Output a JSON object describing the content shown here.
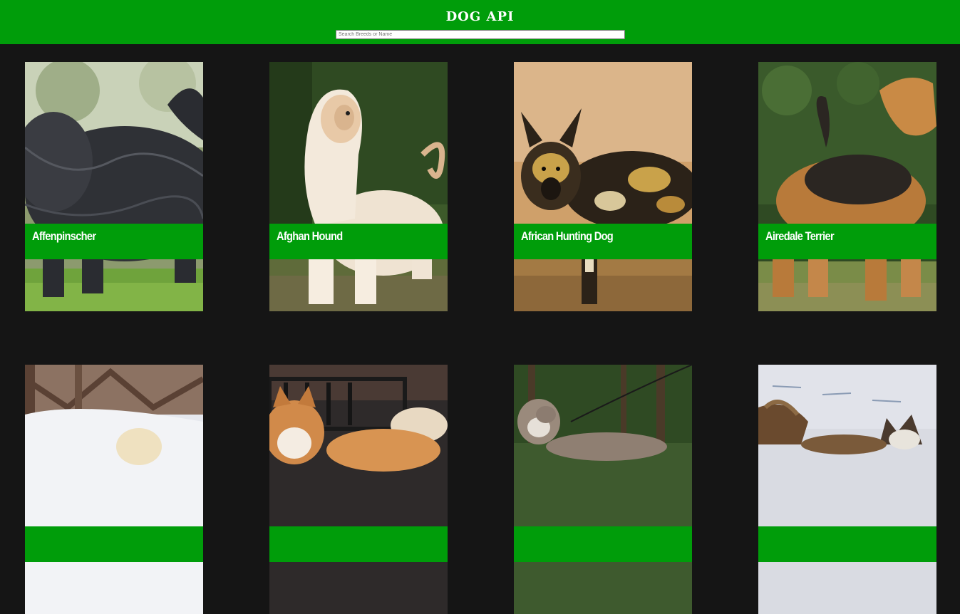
{
  "header": {
    "title": "DOG API",
    "search_placeholder": "Search Breeds or Name",
    "search_value": ""
  },
  "colors": {
    "accent": "#009d0a",
    "background": "#151515",
    "text": "#ffffff"
  },
  "breeds": [
    {
      "name": "Affenpinscher"
    },
    {
      "name": "Afghan Hound"
    },
    {
      "name": "African Hunting Dog"
    },
    {
      "name": "Airedale Terrier"
    },
    {
      "name": ""
    },
    {
      "name": ""
    },
    {
      "name": ""
    },
    {
      "name": ""
    }
  ]
}
